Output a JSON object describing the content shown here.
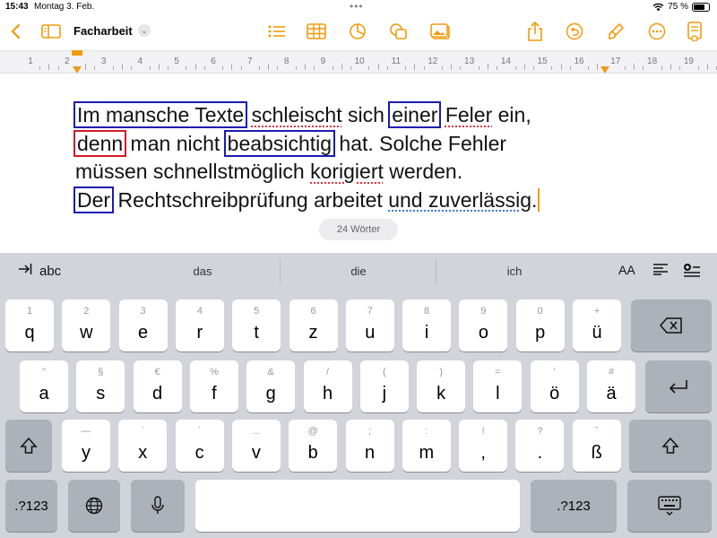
{
  "status": {
    "time": "15:43",
    "date": "Montag 3. Feb.",
    "battery": "75 %",
    "battery_level": 0.75
  },
  "toolbar": {
    "title": "Facharbeit"
  },
  "ruler": {
    "numbers": [
      "1",
      "2",
      "3",
      "4",
      "5",
      "6",
      "7",
      "8",
      "9",
      "10",
      "11",
      "12",
      "13",
      "14",
      "15",
      "16",
      "17",
      "18",
      "19"
    ]
  },
  "document": {
    "line1": {
      "t1": "Im mansche Texte",
      "t2": " ",
      "t3": "schleischt",
      "t4": " sich ",
      "t5": "einer",
      "t6": " ",
      "t7": "Feler",
      "t8": " ein,"
    },
    "line2": {
      "t1": "denn",
      "t2": " man nicht ",
      "t3": "beabsichtig",
      "t4": " hat. Solche Fehler"
    },
    "line3": {
      "t1": "müssen schnellstmöglich ",
      "t2": "korigiert",
      "t3": " werden."
    },
    "line4": {
      "t1": "Der",
      "t2": " Rechtschreibprüfung arbeitet ",
      "t3": "und zuverlässig",
      "t4": "."
    },
    "word_count": "24 Wörter"
  },
  "keyboard": {
    "tab_label": "abc",
    "suggestions": [
      "das",
      "die",
      "ich"
    ],
    "format_label": "AA",
    "row1": [
      {
        "sec": "1",
        "main": "q"
      },
      {
        "sec": "2",
        "main": "w"
      },
      {
        "sec": "3",
        "main": "e"
      },
      {
        "sec": "4",
        "main": "r"
      },
      {
        "sec": "5",
        "main": "t"
      },
      {
        "sec": "6",
        "main": "z"
      },
      {
        "sec": "7",
        "main": "u"
      },
      {
        "sec": "8",
        "main": "i"
      },
      {
        "sec": "9",
        "main": "o"
      },
      {
        "sec": "0",
        "main": "p"
      },
      {
        "sec": "+",
        "main": "ü"
      }
    ],
    "row2": [
      {
        "sec": "\"",
        "main": "a"
      },
      {
        "sec": "§",
        "main": "s"
      },
      {
        "sec": "€",
        "main": "d"
      },
      {
        "sec": "%",
        "main": "f"
      },
      {
        "sec": "&",
        "main": "g"
      },
      {
        "sec": "/",
        "main": "h"
      },
      {
        "sec": "(",
        "main": "j"
      },
      {
        "sec": ")",
        "main": "k"
      },
      {
        "sec": "=",
        "main": "l"
      },
      {
        "sec": "’",
        "main": "ö"
      },
      {
        "sec": "#",
        "main": "ä"
      }
    ],
    "row3": [
      {
        "sec": "—",
        "main": "y"
      },
      {
        "sec": "`",
        "main": "x"
      },
      {
        "sec": "´",
        "main": "c"
      },
      {
        "sec": "...",
        "main": "v"
      },
      {
        "sec": "@",
        "main": "b"
      },
      {
        "sec": ";",
        "main": "n"
      },
      {
        "sec": ":",
        "main": "m"
      },
      {
        "sec": "!",
        "main": ","
      },
      {
        "sec": "?",
        "main": "."
      },
      {
        "sec": "ˇ",
        "main": "ß"
      }
    ],
    "numbers_label": ".?123"
  },
  "colors": {
    "accent": "#f29b0a",
    "box_blue": "#1b1bb0",
    "box_red": "#d11a2a",
    "keyboard_bg": "#d1d4da"
  }
}
